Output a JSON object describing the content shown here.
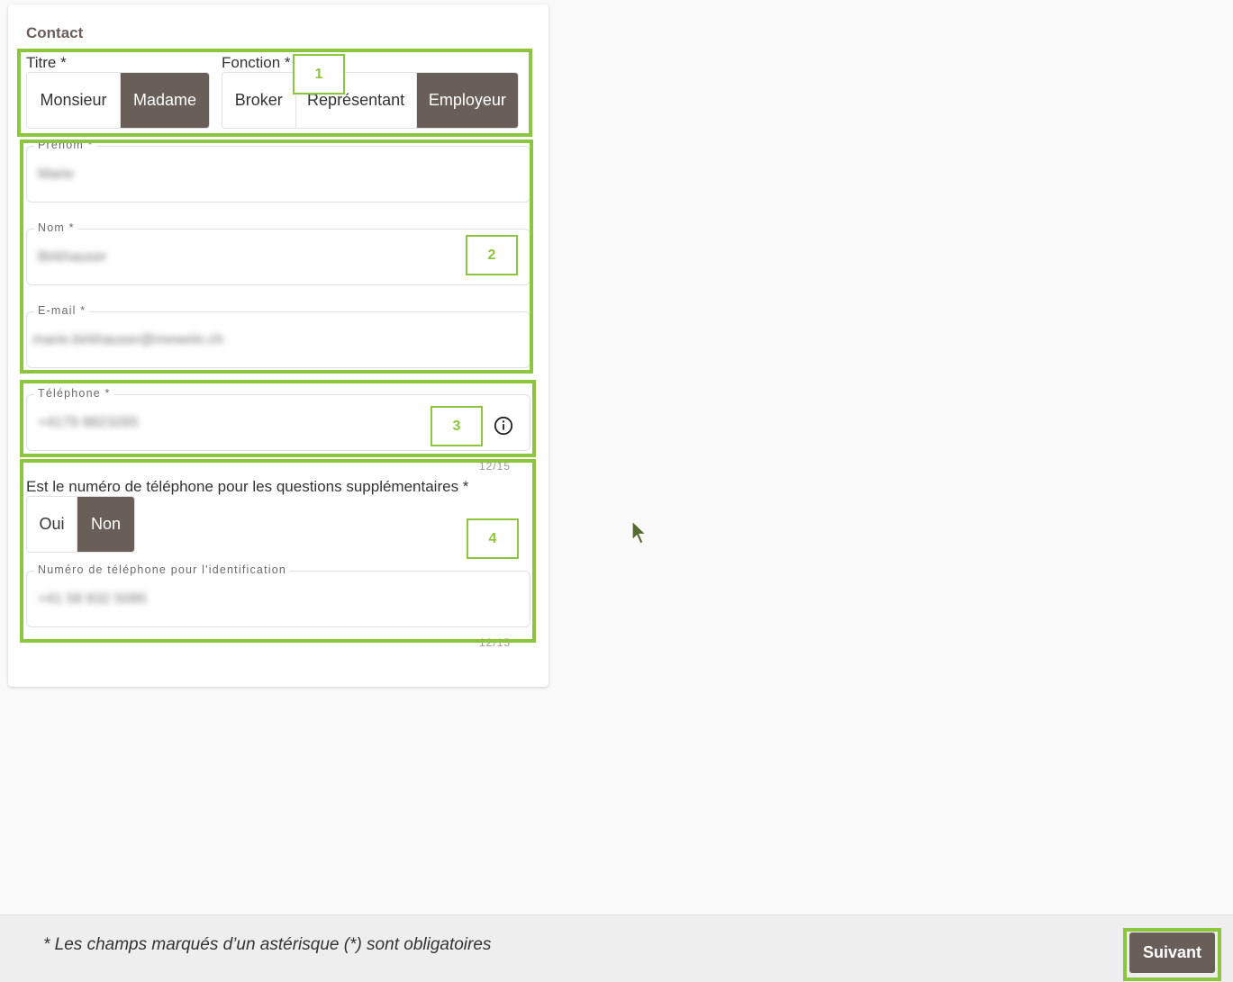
{
  "card": {
    "title": "Contact"
  },
  "titre": {
    "label": "Titre *",
    "options": [
      "Monsieur",
      "Madame"
    ],
    "selected": "Madame"
  },
  "fonction": {
    "label": "Fonction *",
    "options": [
      "Broker",
      "Représentant",
      "Employeur"
    ],
    "selected": "Employeur"
  },
  "fields": {
    "prenom": {
      "label": "Prénom *",
      "value": "Marie"
    },
    "nom": {
      "label": "Nom *",
      "value": "Birkhauser"
    },
    "email": {
      "label": "E-mail *",
      "value": "marie.birkhauser@mewelo.ch"
    },
    "telephone": {
      "label": "Téléphone *",
      "value": "+4179 8823265",
      "counter": "12/15"
    },
    "tel_identification": {
      "label": "Numéro de téléphone pour l'identification",
      "value": "+41 58 832 5090",
      "counter": "12/15"
    }
  },
  "same_phone": {
    "question": "Est le numéro de téléphone pour les questions supplémentaires *",
    "options": [
      "Oui",
      "Non"
    ],
    "selected": "Non"
  },
  "annotations": [
    "1",
    "2",
    "3",
    "4"
  ],
  "footer": {
    "note": "* Les champs marqués d’un astérisque (*) sont obligatoires",
    "next_label": "Suivant"
  },
  "colors": {
    "brand": "#6a5f58",
    "highlight": "#8cc63f"
  },
  "icons": {
    "info": "info-circle-icon",
    "cursor": "mouse-pointer-icon"
  }
}
